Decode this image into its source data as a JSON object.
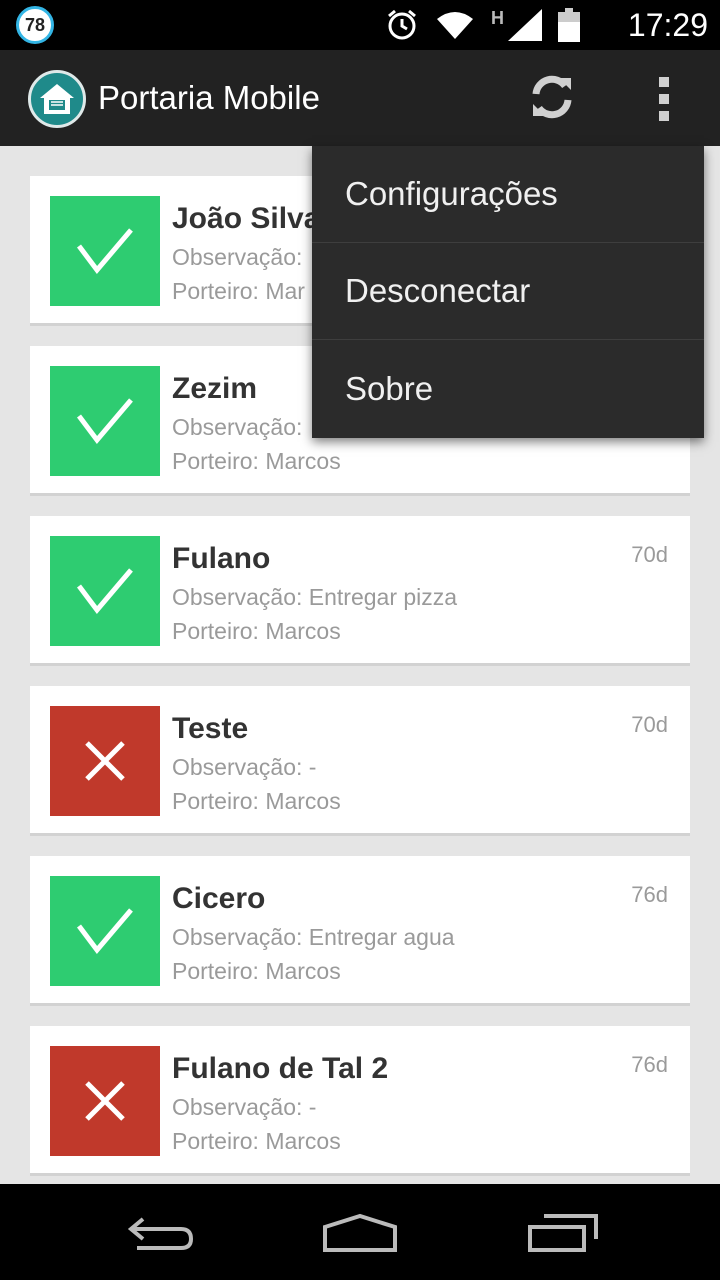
{
  "status_bar": {
    "notification_badge": "78",
    "network_type": "H",
    "time": "17:29",
    "icons": [
      "alarm-icon",
      "wifi-icon",
      "signal-icon",
      "battery-icon"
    ]
  },
  "action_bar": {
    "title": "Portaria Mobile",
    "icons": [
      "app-logo-icon",
      "refresh-icon",
      "overflow-menu-icon"
    ]
  },
  "overflow_menu": {
    "items": [
      {
        "label": "Configurações"
      },
      {
        "label": "Desconectar"
      },
      {
        "label": "Sobre"
      }
    ]
  },
  "visits": [
    {
      "name": "João Silva",
      "observation": "Observação:",
      "doorman": "Porteiro: Mar",
      "age": "",
      "status": "approved"
    },
    {
      "name": "Zezim",
      "observation": "Observação:",
      "doorman": "Porteiro: Marcos",
      "age": "",
      "status": "approved"
    },
    {
      "name": "Fulano",
      "observation": "Observação: Entregar pizza",
      "doorman": "Porteiro: Marcos",
      "age": "70d",
      "status": "approved"
    },
    {
      "name": "Teste",
      "observation": "Observação: -",
      "doorman": "Porteiro: Marcos",
      "age": "70d",
      "status": "denied"
    },
    {
      "name": "Cicero",
      "observation": "Observação: Entregar agua",
      "doorman": "Porteiro: Marcos",
      "age": "76d",
      "status": "approved"
    },
    {
      "name": "Fulano de Tal 2",
      "observation": "Observação: -",
      "doorman": "Porteiro: Marcos",
      "age": "76d",
      "status": "denied"
    }
  ],
  "colors": {
    "approved": "#2ecc71",
    "denied": "#c0392b",
    "action_bar": "#222222",
    "background": "#e5e5e5"
  },
  "nav_bar": {
    "icons": [
      "back-icon",
      "home-icon",
      "recents-icon"
    ]
  }
}
